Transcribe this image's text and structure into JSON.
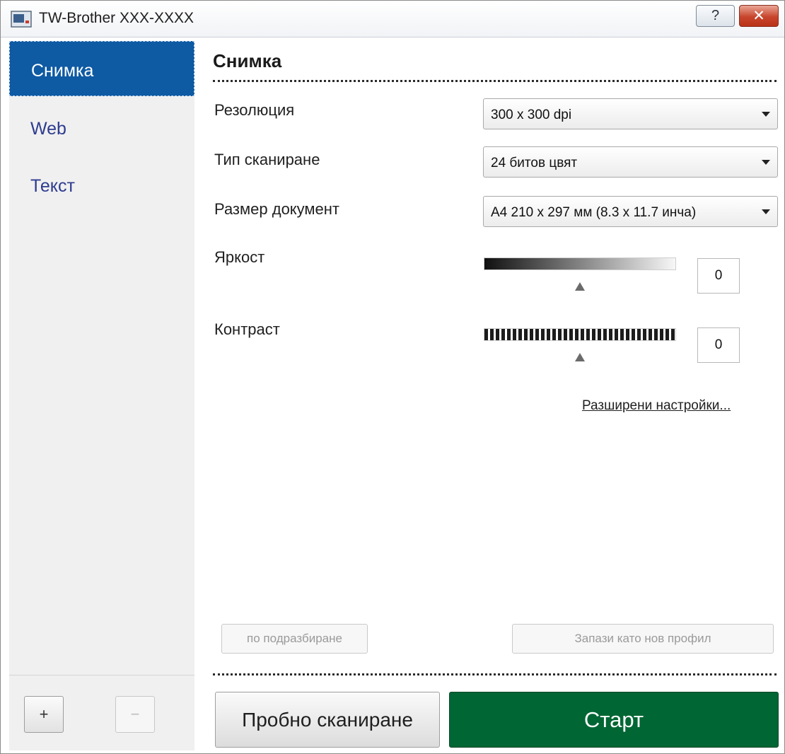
{
  "window": {
    "title": "TW-Brother XXX-XXXX",
    "help_label": "?",
    "close_label": "✕"
  },
  "sidebar": {
    "items": [
      {
        "label": "Снимка",
        "selected": true
      },
      {
        "label": "Web",
        "selected": false
      },
      {
        "label": "Текст",
        "selected": false
      }
    ],
    "add_label": "+",
    "remove_label": "−"
  },
  "panel": {
    "title": "Снимка",
    "resolution": {
      "label": "Резолюция",
      "value": "300 x 300 dpi"
    },
    "scan_type": {
      "label": "Тип сканиране",
      "value": "24 битов цвят"
    },
    "document_size": {
      "label": "Размер документ",
      "value": "A4 210 x 297 мм (8.3 x 11.7 инча)"
    },
    "brightness": {
      "label": "Яркост",
      "value": "0",
      "level": 0.5
    },
    "contrast": {
      "label": "Контраст",
      "value": "0",
      "level": 0.5
    },
    "advanced_link": "Разширени настройки...",
    "default_button": "по подразбиране",
    "save_profile_button": "Запази като нов профил"
  },
  "footer": {
    "preview_button": "Пробно сканиране",
    "start_button": "Старт"
  },
  "colors": {
    "sidebar_selected": "#0e5aa3",
    "sidebar_text": "#2e3c8f",
    "start_button": "#006633",
    "close_button": "#c8452c"
  }
}
